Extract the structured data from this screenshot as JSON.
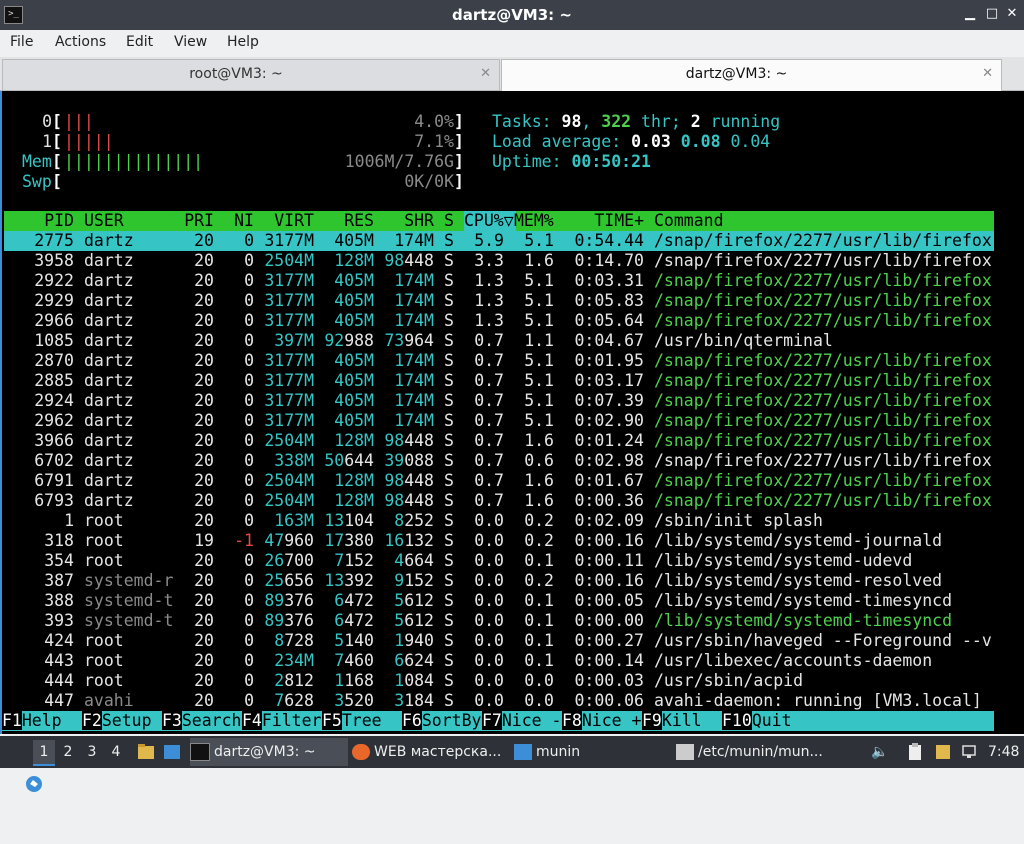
{
  "window": {
    "title": "dartz@VM3: ~",
    "min": "▁",
    "max": "□",
    "close": "✕"
  },
  "menu": [
    "File",
    "Actions",
    "Edit",
    "View",
    "Help"
  ],
  "tabs": [
    {
      "label": "root@VM3: ~",
      "active": false
    },
    {
      "label": "dartz@VM3: ~",
      "active": true
    }
  ],
  "meters": {
    "cpu0": {
      "label": "0",
      "bars": "|||",
      "value": "4.0%"
    },
    "cpu1": {
      "label": "1",
      "bars": "|||||",
      "value": "7.1%"
    },
    "mem": {
      "label": "Mem",
      "bars": "||||||||||||||",
      "value": "1006M/7.76G"
    },
    "swp": {
      "label": "Swp",
      "bars": "",
      "value": "0K/0K"
    }
  },
  "summary": {
    "tasks_label": "Tasks: ",
    "tasks": "98",
    "thr": "322",
    "thr_label": " thr; ",
    "running": "2",
    "running_label": " running",
    "load_label": "Load average: ",
    "load1": "0.03",
    "load5": "0.08",
    "load15": "0.04",
    "uptime_label": "Uptime: ",
    "uptime": "00:50:21"
  },
  "columns": [
    "PID",
    "USER",
    "PRI",
    "NI",
    "VIRT",
    "RES",
    "SHR",
    "S",
    "CPU%▽",
    "MEM%",
    "TIME+",
    "Command"
  ],
  "processes": [
    {
      "pid": "2775",
      "user": "dartz",
      "pri": "20",
      "ni": "0",
      "virt": "3177M",
      "res": "405M",
      "shr": "174M",
      "s": "S",
      "cpu": "5.9",
      "mem": "5.1",
      "time": "0:54.44",
      "cmd": "/snap/firefox/2277/usr/lib/firefox",
      "selected": true,
      "thread": false
    },
    {
      "pid": "3958",
      "user": "dartz",
      "pri": "20",
      "ni": "0",
      "virt": "2504M",
      "res": "128M",
      "shr": "98448",
      "s": "S",
      "cpu": "3.3",
      "mem": "1.6",
      "time": "0:14.70",
      "cmd": "/snap/firefox/2277/usr/lib/firefox",
      "selected": false,
      "thread": false
    },
    {
      "pid": "2922",
      "user": "dartz",
      "pri": "20",
      "ni": "0",
      "virt": "3177M",
      "res": "405M",
      "shr": "174M",
      "s": "S",
      "cpu": "1.3",
      "mem": "5.1",
      "time": "0:03.31",
      "cmd": "/snap/firefox/2277/usr/lib/firefox",
      "selected": false,
      "thread": true
    },
    {
      "pid": "2929",
      "user": "dartz",
      "pri": "20",
      "ni": "0",
      "virt": "3177M",
      "res": "405M",
      "shr": "174M",
      "s": "S",
      "cpu": "1.3",
      "mem": "5.1",
      "time": "0:05.83",
      "cmd": "/snap/firefox/2277/usr/lib/firefox",
      "selected": false,
      "thread": true
    },
    {
      "pid": "2966",
      "user": "dartz",
      "pri": "20",
      "ni": "0",
      "virt": "3177M",
      "res": "405M",
      "shr": "174M",
      "s": "S",
      "cpu": "1.3",
      "mem": "5.1",
      "time": "0:05.64",
      "cmd": "/snap/firefox/2277/usr/lib/firefox",
      "selected": false,
      "thread": true
    },
    {
      "pid": "1085",
      "user": "dartz",
      "pri": "20",
      "ni": "0",
      "virt": "397M",
      "res": "92988",
      "shr": "73964",
      "s": "S",
      "cpu": "0.7",
      "mem": "1.1",
      "time": "0:04.67",
      "cmd": "/usr/bin/qterminal",
      "selected": false,
      "thread": false
    },
    {
      "pid": "2870",
      "user": "dartz",
      "pri": "20",
      "ni": "0",
      "virt": "3177M",
      "res": "405M",
      "shr": "174M",
      "s": "S",
      "cpu": "0.7",
      "mem": "5.1",
      "time": "0:01.95",
      "cmd": "/snap/firefox/2277/usr/lib/firefox",
      "selected": false,
      "thread": true
    },
    {
      "pid": "2885",
      "user": "dartz",
      "pri": "20",
      "ni": "0",
      "virt": "3177M",
      "res": "405M",
      "shr": "174M",
      "s": "S",
      "cpu": "0.7",
      "mem": "5.1",
      "time": "0:03.17",
      "cmd": "/snap/firefox/2277/usr/lib/firefox",
      "selected": false,
      "thread": true
    },
    {
      "pid": "2924",
      "user": "dartz",
      "pri": "20",
      "ni": "0",
      "virt": "3177M",
      "res": "405M",
      "shr": "174M",
      "s": "S",
      "cpu": "0.7",
      "mem": "5.1",
      "time": "0:07.39",
      "cmd": "/snap/firefox/2277/usr/lib/firefox",
      "selected": false,
      "thread": true
    },
    {
      "pid": "2962",
      "user": "dartz",
      "pri": "20",
      "ni": "0",
      "virt": "3177M",
      "res": "405M",
      "shr": "174M",
      "s": "S",
      "cpu": "0.7",
      "mem": "5.1",
      "time": "0:02.90",
      "cmd": "/snap/firefox/2277/usr/lib/firefox",
      "selected": false,
      "thread": true
    },
    {
      "pid": "3966",
      "user": "dartz",
      "pri": "20",
      "ni": "0",
      "virt": "2504M",
      "res": "128M",
      "shr": "98448",
      "s": "S",
      "cpu": "0.7",
      "mem": "1.6",
      "time": "0:01.24",
      "cmd": "/snap/firefox/2277/usr/lib/firefox",
      "selected": false,
      "thread": true
    },
    {
      "pid": "6702",
      "user": "dartz",
      "pri": "20",
      "ni": "0",
      "virt": "338M",
      "res": "50644",
      "shr": "39088",
      "s": "S",
      "cpu": "0.7",
      "mem": "0.6",
      "time": "0:02.98",
      "cmd": "/snap/firefox/2277/usr/lib/firefox",
      "selected": false,
      "thread": false
    },
    {
      "pid": "6791",
      "user": "dartz",
      "pri": "20",
      "ni": "0",
      "virt": "2504M",
      "res": "128M",
      "shr": "98448",
      "s": "S",
      "cpu": "0.7",
      "mem": "1.6",
      "time": "0:01.67",
      "cmd": "/snap/firefox/2277/usr/lib/firefox",
      "selected": false,
      "thread": true
    },
    {
      "pid": "6793",
      "user": "dartz",
      "pri": "20",
      "ni": "0",
      "virt": "2504M",
      "res": "128M",
      "shr": "98448",
      "s": "S",
      "cpu": "0.7",
      "mem": "1.6",
      "time": "0:00.36",
      "cmd": "/snap/firefox/2277/usr/lib/firefox",
      "selected": false,
      "thread": true
    },
    {
      "pid": "1",
      "user": "root",
      "pri": "20",
      "ni": "0",
      "virt": "163M",
      "res": "13104",
      "shr": "8252",
      "s": "S",
      "cpu": "0.0",
      "mem": "0.2",
      "time": "0:02.09",
      "cmd": "/sbin/init splash",
      "selected": false,
      "thread": false
    },
    {
      "pid": "318",
      "user": "root",
      "pri": "19",
      "ni": "-1",
      "virt": "47960",
      "res": "17380",
      "shr": "16132",
      "s": "S",
      "cpu": "0.0",
      "mem": "0.2",
      "time": "0:00.16",
      "cmd": "/lib/systemd/systemd-journald",
      "selected": false,
      "thread": false
    },
    {
      "pid": "354",
      "user": "root",
      "pri": "20",
      "ni": "0",
      "virt": "26700",
      "res": "7152",
      "shr": "4664",
      "s": "S",
      "cpu": "0.0",
      "mem": "0.1",
      "time": "0:00.11",
      "cmd": "/lib/systemd/systemd-udevd",
      "selected": false,
      "thread": false
    },
    {
      "pid": "387",
      "user": "systemd-r",
      "pri": "20",
      "ni": "0",
      "virt": "25656",
      "res": "13392",
      "shr": "9152",
      "s": "S",
      "cpu": "0.0",
      "mem": "0.2",
      "time": "0:00.16",
      "cmd": "/lib/systemd/systemd-resolved",
      "selected": false,
      "thread": false
    },
    {
      "pid": "388",
      "user": "systemd-t",
      "pri": "20",
      "ni": "0",
      "virt": "89376",
      "res": "6472",
      "shr": "5612",
      "s": "S",
      "cpu": "0.0",
      "mem": "0.1",
      "time": "0:00.05",
      "cmd": "/lib/systemd/systemd-timesyncd",
      "selected": false,
      "thread": false
    },
    {
      "pid": "393",
      "user": "systemd-t",
      "pri": "20",
      "ni": "0",
      "virt": "89376",
      "res": "6472",
      "shr": "5612",
      "s": "S",
      "cpu": "0.0",
      "mem": "0.1",
      "time": "0:00.00",
      "cmd": "/lib/systemd/systemd-timesyncd",
      "selected": false,
      "thread": true
    },
    {
      "pid": "424",
      "user": "root",
      "pri": "20",
      "ni": "0",
      "virt": "8728",
      "res": "5140",
      "shr": "1940",
      "s": "S",
      "cpu": "0.0",
      "mem": "0.1",
      "time": "0:00.27",
      "cmd": "/usr/sbin/haveged --Foreground --v",
      "selected": false,
      "thread": false
    },
    {
      "pid": "443",
      "user": "root",
      "pri": "20",
      "ni": "0",
      "virt": "234M",
      "res": "7460",
      "shr": "6624",
      "s": "S",
      "cpu": "0.0",
      "mem": "0.1",
      "time": "0:00.14",
      "cmd": "/usr/libexec/accounts-daemon",
      "selected": false,
      "thread": false
    },
    {
      "pid": "444",
      "user": "root",
      "pri": "20",
      "ni": "0",
      "virt": "2812",
      "res": "1168",
      "shr": "1084",
      "s": "S",
      "cpu": "0.0",
      "mem": "0.0",
      "time": "0:00.03",
      "cmd": "/usr/sbin/acpid",
      "selected": false,
      "thread": false
    },
    {
      "pid": "447",
      "user": "avahi",
      "pri": "20",
      "ni": "0",
      "virt": "7628",
      "res": "3520",
      "shr": "3184",
      "s": "S",
      "cpu": "0.0",
      "mem": "0.0",
      "time": "0:00.06",
      "cmd": "avahi-daemon: running [VM3.local]",
      "selected": false,
      "thread": false
    }
  ],
  "fkeys": [
    {
      "key": "F1",
      "label": "Help  "
    },
    {
      "key": "F2",
      "label": "Setup "
    },
    {
      "key": "F3",
      "label": "Search"
    },
    {
      "key": "F4",
      "label": "Filter"
    },
    {
      "key": "F5",
      "label": "Tree  "
    },
    {
      "key": "F6",
      "label": "SortBy"
    },
    {
      "key": "F7",
      "label": "Nice -"
    },
    {
      "key": "F8",
      "label": "Nice +"
    },
    {
      "key": "F9",
      "label": "Kill  "
    },
    {
      "key": "F10",
      "label": "Quit  "
    }
  ],
  "taskbar": {
    "desktops": [
      "1",
      "2",
      "3",
      "4"
    ],
    "tasks": [
      "dartz@VM3: ~",
      "WEB мастерска...",
      "munin",
      "/etc/munin/mun..."
    ],
    "clock": "7:48"
  }
}
